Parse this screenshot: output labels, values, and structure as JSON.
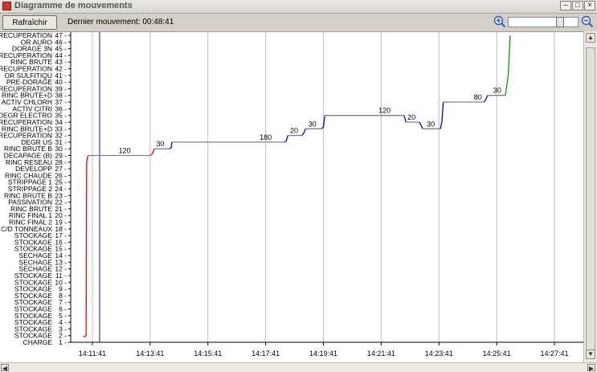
{
  "window": {
    "title": "Diagramme de mouvements"
  },
  "toolbar": {
    "refresh_label": "Rafraîchir",
    "last_move_label": "Dernier mouvement: 00:48:41",
    "zoom_in_icon": "zoom-in-magnifier-icon",
    "zoom_out_icon": "zoom-out-magnifier-icon",
    "zoom_level": 0.78
  },
  "chart_data": {
    "type": "line",
    "title": "",
    "xlabel": "",
    "ylabel": "",
    "x_ticks": [
      "14:11:41",
      "14:13:41",
      "14:15:41",
      "14:17:41",
      "14:19:41",
      "14:21:41",
      "14:23:41",
      "14:25:41",
      "14:27:41"
    ],
    "xlim": [
      "14:10:56",
      "14:28:41"
    ],
    "ylim": [
      1,
      47
    ],
    "y_ticks": [
      {
        "v": 1,
        "label": "CHARGE"
      },
      {
        "v": 2,
        "label": "STOCKAGE"
      },
      {
        "v": 3,
        "label": "STOCKAGE"
      },
      {
        "v": 4,
        "label": "STOCKAGE"
      },
      {
        "v": 5,
        "label": "STOCKAGE"
      },
      {
        "v": 6,
        "label": "STOCKAGE"
      },
      {
        "v": 7,
        "label": "STOCKAGE"
      },
      {
        "v": 8,
        "label": "STOCKAGE"
      },
      {
        "v": 9,
        "label": "STOCKAGE"
      },
      {
        "v": 10,
        "label": "STOCKAGE"
      },
      {
        "v": 11,
        "label": "STOCKAGE"
      },
      {
        "v": 12,
        "label": "SECHAGE"
      },
      {
        "v": 13,
        "label": "SECHAGE"
      },
      {
        "v": 14,
        "label": "SECHAGE"
      },
      {
        "v": 15,
        "label": "STOCKAGE"
      },
      {
        "v": 16,
        "label": "STOCKAGE"
      },
      {
        "v": 17,
        "label": "STOCKAGE"
      },
      {
        "v": 18,
        "label": "C/D TONNEAUX"
      },
      {
        "v": 19,
        "label": "RINC FINAL 2"
      },
      {
        "v": 20,
        "label": "RINC FINAL 1"
      },
      {
        "v": 21,
        "label": "RINC BRUTE"
      },
      {
        "v": 22,
        "label": "PASSIVATION"
      },
      {
        "v": 23,
        "label": "RINC BRUTE B"
      },
      {
        "v": 24,
        "label": "STRIPPAGE 2"
      },
      {
        "v": 25,
        "label": "STRIPPAGE 1"
      },
      {
        "v": 26,
        "label": "RINC CHAUDE"
      },
      {
        "v": 27,
        "label": "DEVELOPP"
      },
      {
        "v": 28,
        "label": "RINC RESEAU"
      },
      {
        "v": 29,
        "label": "DECAPAGE (B)"
      },
      {
        "v": 30,
        "label": "RINC BRUTE B"
      },
      {
        "v": 31,
        "label": "DEGR US"
      },
      {
        "v": 32,
        "label": "RECUPERATION"
      },
      {
        "v": 33,
        "label": "RINC BRUTE+D"
      },
      {
        "v": 34,
        "label": "RECUPERATION"
      },
      {
        "v": 35,
        "label": "DEGR ELECTRO"
      },
      {
        "v": 36,
        "label": "ACTIV CITRI"
      },
      {
        "v": 37,
        "label": "ACTIV CHLORH"
      },
      {
        "v": 38,
        "label": "RINC BRUTE+D"
      },
      {
        "v": 39,
        "label": "RECUPERATION"
      },
      {
        "v": 40,
        "label": "PRE-DORAGE"
      },
      {
        "v": 41,
        "label": "OR SULFITIQU"
      },
      {
        "v": 42,
        "label": "RECUPERATION"
      },
      {
        "v": 43,
        "label": "RINC BRUTE"
      },
      {
        "v": 44,
        "label": "RECUPERATION"
      },
      {
        "v": 45,
        "label": "DORAGE 3N"
      },
      {
        "v": 46,
        "label": "OR AURO"
      },
      {
        "v": 47,
        "label": "RECUPERATION"
      }
    ],
    "current_time": "14:11:56",
    "colors": {
      "rise": "#ff0000",
      "dwell": "#808080",
      "transfer": "#0000ff",
      "final_rise": "#00a000",
      "cursor": "#3333ff",
      "grid": "#c0c0c0"
    },
    "series": [
      {
        "color": "#ff0000",
        "points": [
          [
            "14:11:22",
            1.8
          ],
          [
            "14:11:28",
            2
          ],
          [
            "14:11:29",
            28
          ],
          [
            "14:11:32",
            29
          ]
        ]
      },
      {
        "color": "#808080",
        "points": [
          [
            "14:11:32",
            29
          ],
          [
            "14:12:48",
            29
          ],
          [
            "14:13:42",
            29
          ]
        ]
      },
      {
        "color": "#ff0000",
        "points": [
          [
            "14:13:42",
            29
          ],
          [
            "14:13:48",
            29.5
          ],
          [
            "14:13:49",
            30
          ]
        ]
      },
      {
        "color": "#808080",
        "points": [
          [
            "14:13:49",
            30
          ],
          [
            "14:14:21",
            30
          ]
        ]
      },
      {
        "color": "#0000ff",
        "points": [
          [
            "14:14:21",
            30
          ],
          [
            "14:14:25",
            30.2
          ],
          [
            "14:14:26",
            31
          ]
        ]
      },
      {
        "color": "#808080",
        "points": [
          [
            "14:14:26",
            31
          ],
          [
            "14:17:41",
            31
          ],
          [
            "14:18:20",
            31
          ]
        ]
      },
      {
        "color": "#0000ff",
        "points": [
          [
            "14:18:20",
            31
          ],
          [
            "14:18:24",
            31.2
          ],
          [
            "14:18:27",
            32
          ]
        ]
      },
      {
        "color": "#808080",
        "points": [
          [
            "14:18:27",
            32
          ],
          [
            "14:18:56",
            32
          ]
        ]
      },
      {
        "color": "#0000ff",
        "points": [
          [
            "14:18:56",
            32
          ],
          [
            "14:19:00",
            32.3
          ],
          [
            "14:19:04",
            33
          ]
        ]
      },
      {
        "color": "#808080",
        "points": [
          [
            "14:19:04",
            33
          ],
          [
            "14:19:37",
            33
          ]
        ]
      },
      {
        "color": "#0000ff",
        "points": [
          [
            "14:19:37",
            33
          ],
          [
            "14:19:41",
            33.3
          ],
          [
            "14:19:44",
            35
          ]
        ]
      },
      {
        "color": "#808080",
        "points": [
          [
            "14:19:44",
            35
          ],
          [
            "14:22:28",
            35
          ]
        ]
      },
      {
        "color": "#0000ff",
        "points": [
          [
            "14:22:28",
            35
          ],
          [
            "14:22:31",
            34.5
          ],
          [
            "14:22:32",
            34
          ]
        ]
      },
      {
        "color": "#808080",
        "points": [
          [
            "14:22:32",
            34
          ],
          [
            "14:23:00",
            34
          ]
        ]
      },
      {
        "color": "#0000ff",
        "points": [
          [
            "14:23:00",
            34
          ],
          [
            "14:23:04",
            33.5
          ],
          [
            "14:23:07",
            33
          ]
        ]
      },
      {
        "color": "#808080",
        "points": [
          [
            "14:23:07",
            33
          ],
          [
            "14:23:44",
            33
          ]
        ]
      },
      {
        "color": "#0000ff",
        "points": [
          [
            "14:23:44",
            33
          ],
          [
            "14:23:47",
            34
          ],
          [
            "14:23:50",
            37
          ]
        ]
      },
      {
        "color": "#808080",
        "points": [
          [
            "14:23:50",
            37
          ],
          [
            "14:25:15",
            37
          ]
        ]
      },
      {
        "color": "#0000ff",
        "points": [
          [
            "14:25:15",
            37
          ],
          [
            "14:25:19",
            37.5
          ],
          [
            "14:25:22",
            38
          ]
        ]
      },
      {
        "color": "#808080",
        "points": [
          [
            "14:25:22",
            38
          ],
          [
            "14:25:59",
            38
          ]
        ]
      },
      {
        "color": "#00a000",
        "points": [
          [
            "14:25:59",
            38
          ],
          [
            "14:26:05",
            41
          ],
          [
            "14:26:09",
            47
          ]
        ]
      }
    ],
    "annotations": [
      {
        "t": "14:12:48",
        "y": 29,
        "text": "120"
      },
      {
        "t": "14:14:02",
        "y": 30,
        "text": "30"
      },
      {
        "t": "14:17:41",
        "y": 31,
        "text": "180"
      },
      {
        "t": "14:18:40",
        "y": 32,
        "text": "20"
      },
      {
        "t": "14:19:18",
        "y": 33,
        "text": "30"
      },
      {
        "t": "14:21:48",
        "y": 35,
        "text": "120"
      },
      {
        "t": "14:22:44",
        "y": 34,
        "text": "20"
      },
      {
        "t": "14:23:24",
        "y": 33,
        "text": "30"
      },
      {
        "t": "14:25:02",
        "y": 37,
        "text": "80"
      },
      {
        "t": "14:25:42",
        "y": 38,
        "text": "30"
      }
    ]
  }
}
